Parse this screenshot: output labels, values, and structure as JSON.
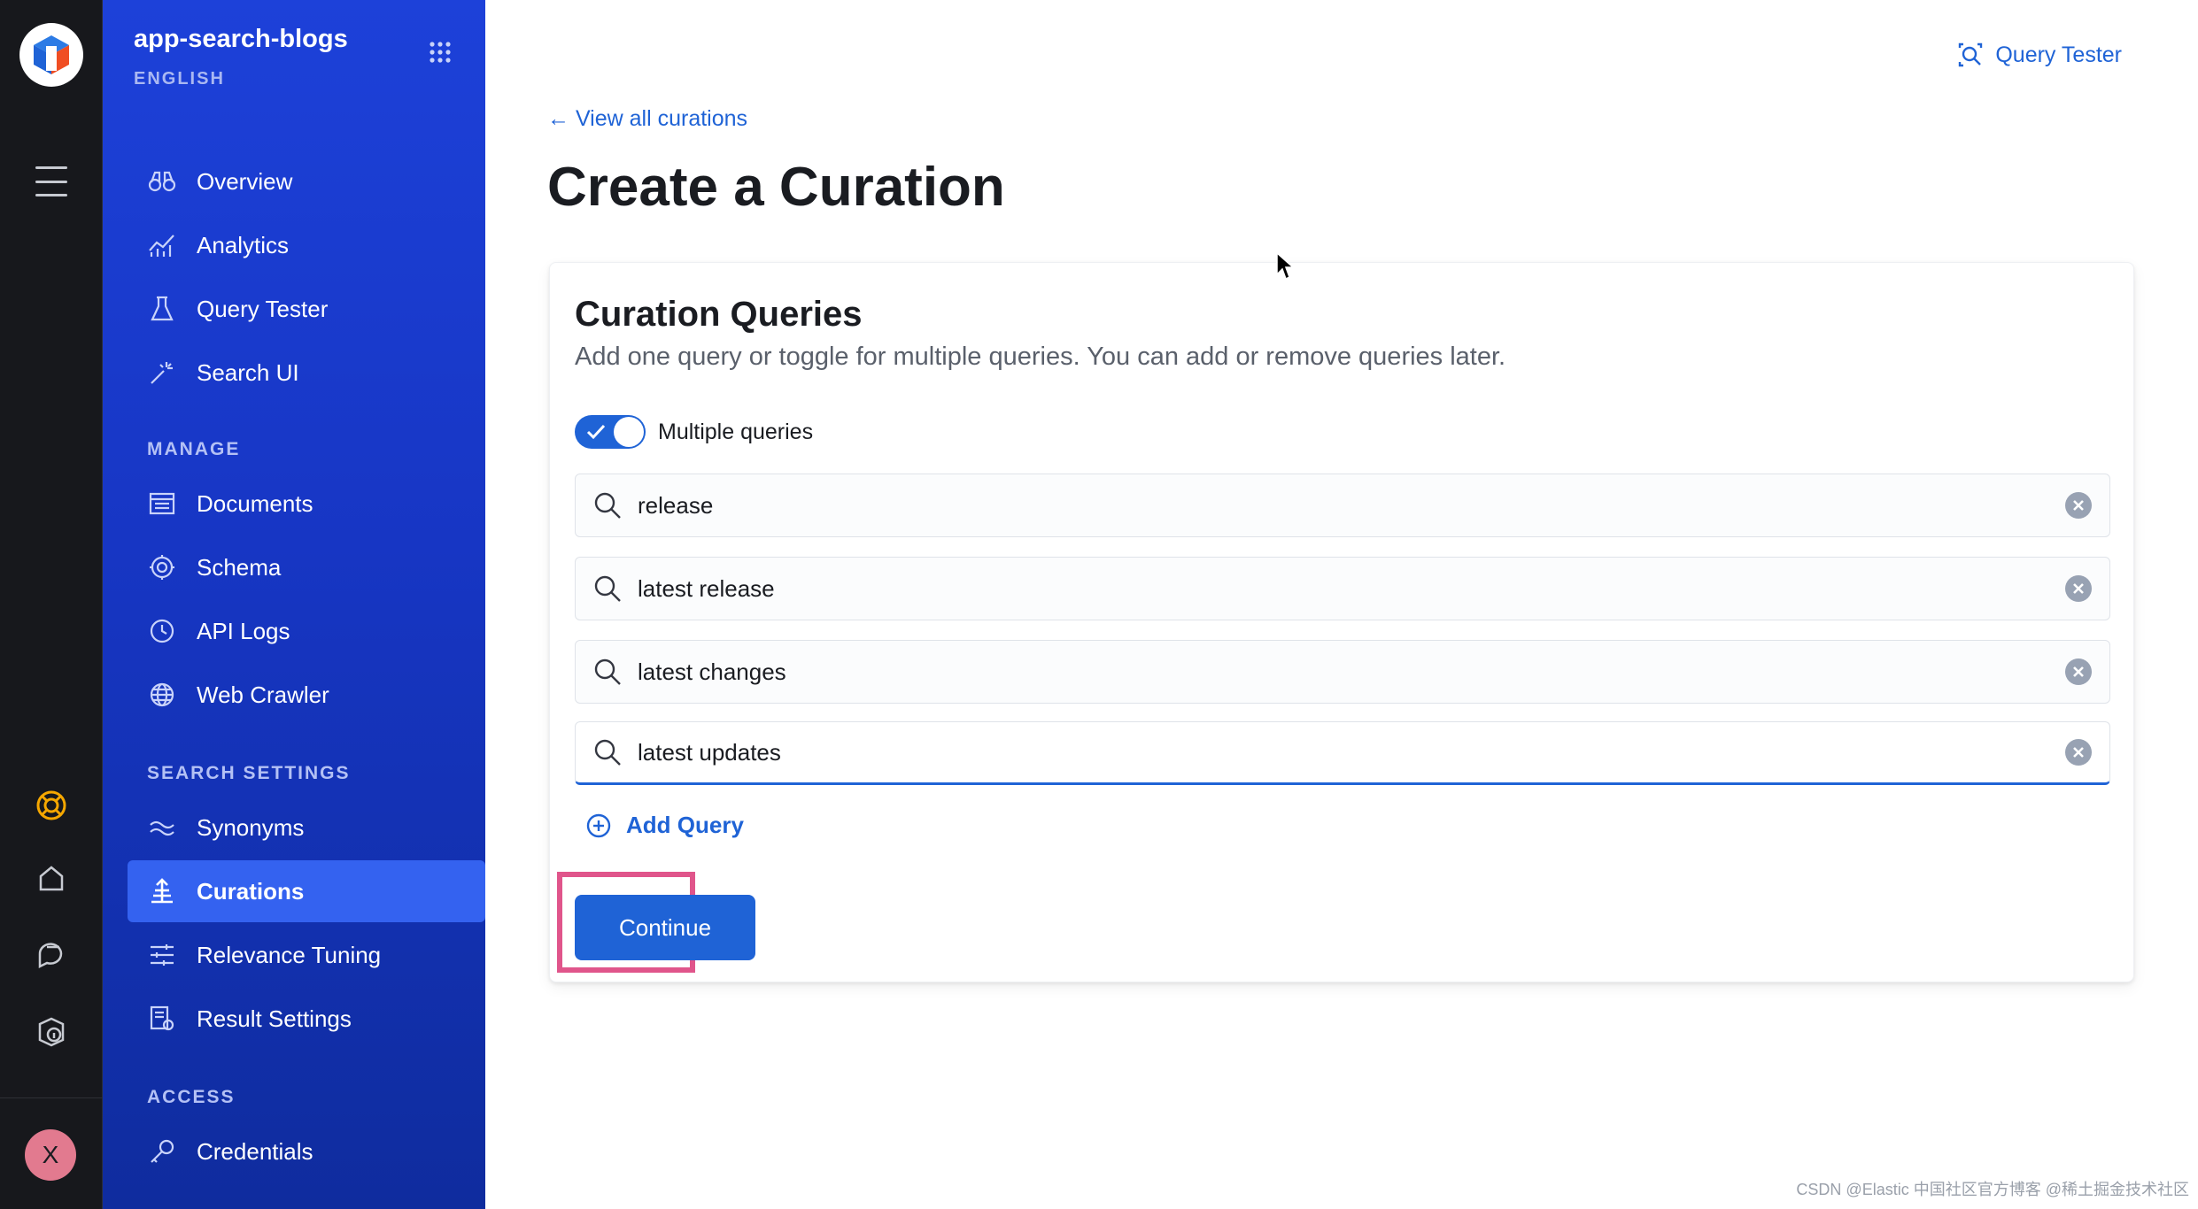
{
  "app": {
    "name": "app-search-blogs",
    "language": "ENGLISH"
  },
  "sidebar": {
    "items": [
      {
        "label": "Overview",
        "icon": "binoculars-icon"
      },
      {
        "label": "Analytics",
        "icon": "analytics-icon"
      },
      {
        "label": "Query Tester",
        "icon": "beaker-icon"
      },
      {
        "label": "Search UI",
        "icon": "magic-wand-icon"
      }
    ],
    "sections": [
      {
        "title": "MANAGE",
        "items": [
          {
            "label": "Documents",
            "icon": "documents-icon"
          },
          {
            "label": "Schema",
            "icon": "gear-icon"
          },
          {
            "label": "API Logs",
            "icon": "clock-icon"
          },
          {
            "label": "Web Crawler",
            "icon": "globe-icon"
          }
        ]
      },
      {
        "title": "SEARCH SETTINGS",
        "items": [
          {
            "label": "Synonyms",
            "icon": "synonyms-icon"
          },
          {
            "label": "Curations",
            "icon": "curations-icon",
            "active": true
          },
          {
            "label": "Relevance Tuning",
            "icon": "sliders-icon"
          },
          {
            "label": "Result Settings",
            "icon": "result-settings-icon"
          }
        ]
      },
      {
        "title": "ACCESS",
        "items": [
          {
            "label": "Credentials",
            "icon": "key-icon"
          }
        ]
      }
    ]
  },
  "rail": {
    "avatar_initial": "X"
  },
  "header": {
    "query_tester_label": "Query Tester"
  },
  "main": {
    "back_link": "← View all curations",
    "title": "Create a Curation",
    "panel": {
      "title": "Curation Queries",
      "description": "Add one query or toggle for multiple queries. You can add or remove queries later.",
      "toggle_label": "Multiple queries",
      "toggle_on": true,
      "queries": [
        "release",
        "latest release",
        "latest changes",
        "latest updates"
      ],
      "add_query_label": "Add Query",
      "continue_label": "Continue"
    }
  },
  "colors": {
    "accent": "#1f63d6",
    "sidebar": "#1d41d9",
    "active_item": "#3462f0",
    "highlight": "#e0558b"
  },
  "watermark": "CSDN @Elastic 中国社区官方博客  @稀土掘金技术社区"
}
